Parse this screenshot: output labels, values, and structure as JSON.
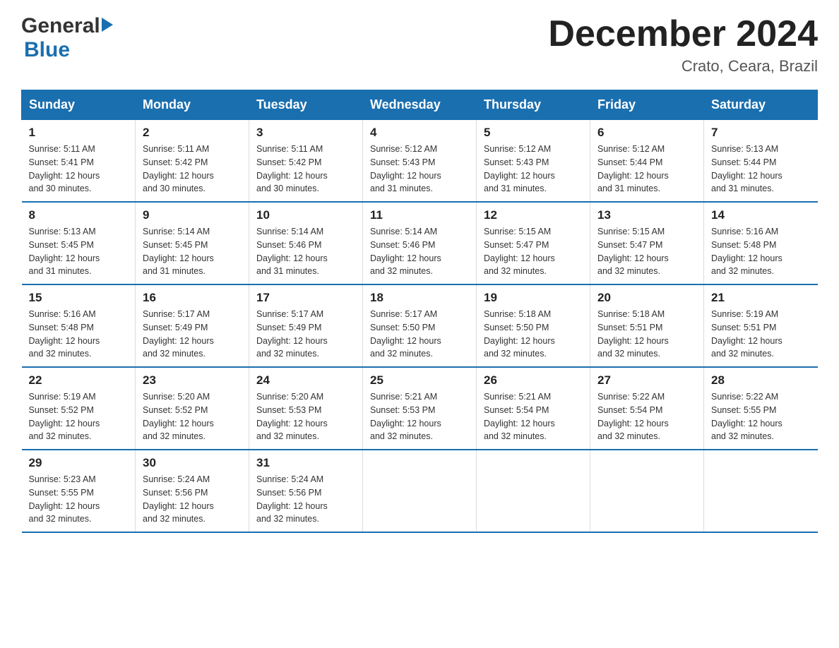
{
  "logo": {
    "general": "General",
    "blue": "Blue",
    "tagline": "GeneralBlue"
  },
  "title": "December 2024",
  "subtitle": "Crato, Ceara, Brazil",
  "headers": [
    "Sunday",
    "Monday",
    "Tuesday",
    "Wednesday",
    "Thursday",
    "Friday",
    "Saturday"
  ],
  "weeks": [
    [
      {
        "day": "1",
        "sunrise": "5:11 AM",
        "sunset": "5:41 PM",
        "daylight": "12 hours and 30 minutes."
      },
      {
        "day": "2",
        "sunrise": "5:11 AM",
        "sunset": "5:42 PM",
        "daylight": "12 hours and 30 minutes."
      },
      {
        "day": "3",
        "sunrise": "5:11 AM",
        "sunset": "5:42 PM",
        "daylight": "12 hours and 30 minutes."
      },
      {
        "day": "4",
        "sunrise": "5:12 AM",
        "sunset": "5:43 PM",
        "daylight": "12 hours and 31 minutes."
      },
      {
        "day": "5",
        "sunrise": "5:12 AM",
        "sunset": "5:43 PM",
        "daylight": "12 hours and 31 minutes."
      },
      {
        "day": "6",
        "sunrise": "5:12 AM",
        "sunset": "5:44 PM",
        "daylight": "12 hours and 31 minutes."
      },
      {
        "day": "7",
        "sunrise": "5:13 AM",
        "sunset": "5:44 PM",
        "daylight": "12 hours and 31 minutes."
      }
    ],
    [
      {
        "day": "8",
        "sunrise": "5:13 AM",
        "sunset": "5:45 PM",
        "daylight": "12 hours and 31 minutes."
      },
      {
        "day": "9",
        "sunrise": "5:14 AM",
        "sunset": "5:45 PM",
        "daylight": "12 hours and 31 minutes."
      },
      {
        "day": "10",
        "sunrise": "5:14 AM",
        "sunset": "5:46 PM",
        "daylight": "12 hours and 31 minutes."
      },
      {
        "day": "11",
        "sunrise": "5:14 AM",
        "sunset": "5:46 PM",
        "daylight": "12 hours and 32 minutes."
      },
      {
        "day": "12",
        "sunrise": "5:15 AM",
        "sunset": "5:47 PM",
        "daylight": "12 hours and 32 minutes."
      },
      {
        "day": "13",
        "sunrise": "5:15 AM",
        "sunset": "5:47 PM",
        "daylight": "12 hours and 32 minutes."
      },
      {
        "day": "14",
        "sunrise": "5:16 AM",
        "sunset": "5:48 PM",
        "daylight": "12 hours and 32 minutes."
      }
    ],
    [
      {
        "day": "15",
        "sunrise": "5:16 AM",
        "sunset": "5:48 PM",
        "daylight": "12 hours and 32 minutes."
      },
      {
        "day": "16",
        "sunrise": "5:17 AM",
        "sunset": "5:49 PM",
        "daylight": "12 hours and 32 minutes."
      },
      {
        "day": "17",
        "sunrise": "5:17 AM",
        "sunset": "5:49 PM",
        "daylight": "12 hours and 32 minutes."
      },
      {
        "day": "18",
        "sunrise": "5:17 AM",
        "sunset": "5:50 PM",
        "daylight": "12 hours and 32 minutes."
      },
      {
        "day": "19",
        "sunrise": "5:18 AM",
        "sunset": "5:50 PM",
        "daylight": "12 hours and 32 minutes."
      },
      {
        "day": "20",
        "sunrise": "5:18 AM",
        "sunset": "5:51 PM",
        "daylight": "12 hours and 32 minutes."
      },
      {
        "day": "21",
        "sunrise": "5:19 AM",
        "sunset": "5:51 PM",
        "daylight": "12 hours and 32 minutes."
      }
    ],
    [
      {
        "day": "22",
        "sunrise": "5:19 AM",
        "sunset": "5:52 PM",
        "daylight": "12 hours and 32 minutes."
      },
      {
        "day": "23",
        "sunrise": "5:20 AM",
        "sunset": "5:52 PM",
        "daylight": "12 hours and 32 minutes."
      },
      {
        "day": "24",
        "sunrise": "5:20 AM",
        "sunset": "5:53 PM",
        "daylight": "12 hours and 32 minutes."
      },
      {
        "day": "25",
        "sunrise": "5:21 AM",
        "sunset": "5:53 PM",
        "daylight": "12 hours and 32 minutes."
      },
      {
        "day": "26",
        "sunrise": "5:21 AM",
        "sunset": "5:54 PM",
        "daylight": "12 hours and 32 minutes."
      },
      {
        "day": "27",
        "sunrise": "5:22 AM",
        "sunset": "5:54 PM",
        "daylight": "12 hours and 32 minutes."
      },
      {
        "day": "28",
        "sunrise": "5:22 AM",
        "sunset": "5:55 PM",
        "daylight": "12 hours and 32 minutes."
      }
    ],
    [
      {
        "day": "29",
        "sunrise": "5:23 AM",
        "sunset": "5:55 PM",
        "daylight": "12 hours and 32 minutes."
      },
      {
        "day": "30",
        "sunrise": "5:24 AM",
        "sunset": "5:56 PM",
        "daylight": "12 hours and 32 minutes."
      },
      {
        "day": "31",
        "sunrise": "5:24 AM",
        "sunset": "5:56 PM",
        "daylight": "12 hours and 32 minutes."
      },
      null,
      null,
      null,
      null
    ]
  ],
  "labels": {
    "sunrise": "Sunrise:",
    "sunset": "Sunset:",
    "daylight": "Daylight:"
  }
}
